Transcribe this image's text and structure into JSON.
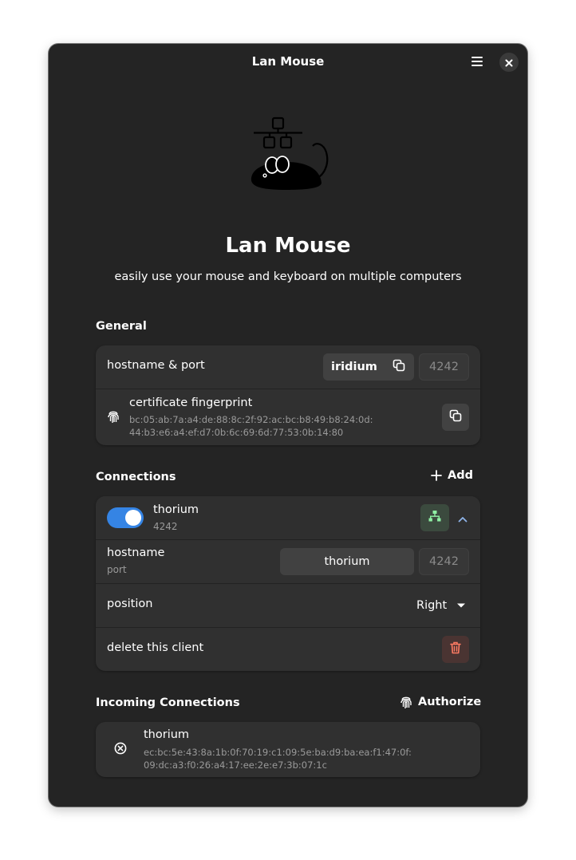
{
  "window": {
    "title": "Lan Mouse"
  },
  "app": {
    "name": "Lan Mouse",
    "description": "easily use your mouse and keyboard on multiple computers"
  },
  "general": {
    "title": "General",
    "hostname_label": "hostname & port",
    "hostname_value": "iridium",
    "port_placeholder": "4242",
    "fingerprint_label": "certificate fingerprint",
    "fingerprint_line1": "bc:05:ab:7a:a4:de:88:8c:2f:92:ac:bc:b8:49:b8:24:0d:",
    "fingerprint_line2": "44:b3:e6:a4:ef:d7:0b:6c:69:6d:77:53:0b:14:80"
  },
  "connections": {
    "title": "Connections",
    "add_label": "Add",
    "client": {
      "name": "thorium",
      "port": "4242",
      "enabled": true,
      "hostname_label": "hostname",
      "port_label": "port",
      "hostname_value": "thorium",
      "port_placeholder": "4242",
      "position_label": "position",
      "position_value": "Right",
      "delete_label": "delete this client"
    }
  },
  "incoming": {
    "title": "Incoming Connections",
    "authorize_label": "Authorize",
    "items": [
      {
        "name": "thorium",
        "fingerprint_line1": "ec:bc:5e:43:8a:1b:0f:70:19:c1:09:5e:ba:d9:ba:ea:f1:47:0f:",
        "fingerprint_line2": "09:dc:a3:f0:26:a4:17:ee:2e:e7:3b:07:1c"
      }
    ]
  },
  "colors": {
    "window_bg": "#242424",
    "card_bg": "#303030",
    "accent": "#3584e4",
    "success": "#8ff0a4",
    "destructive": "#ff7b63"
  },
  "icons": {
    "menu": "hamburger-menu-icon",
    "close": "close-icon",
    "copy": "copy-icon",
    "fingerprint": "fingerprint-icon",
    "add": "plus-icon",
    "network": "network-wired-icon",
    "expand": "chevron-up-icon",
    "dropdown": "pan-down-icon",
    "delete": "trash-icon",
    "reject": "circle-x-icon"
  }
}
